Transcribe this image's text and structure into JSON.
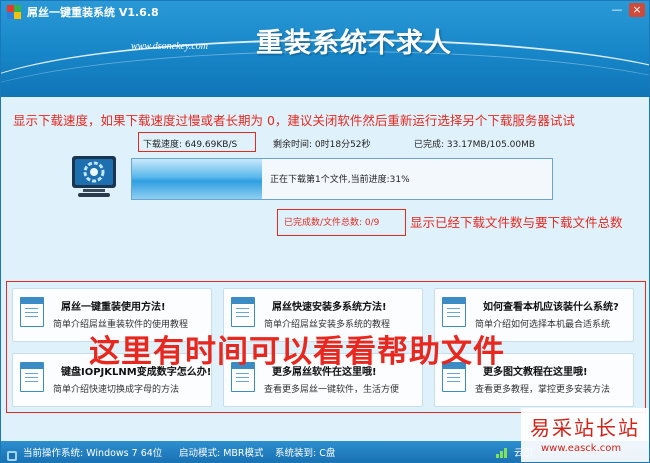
{
  "window": {
    "title": "屌丝一键重装系统 V1.6.8",
    "website": "www.dsonekey.com",
    "slogan": "重装系统不求人",
    "buttons": {
      "minimize": "—",
      "close": "×"
    },
    "logo_colors": [
      "#e53a2c",
      "#36b24a",
      "#2e7fd9",
      "#f4c20d"
    ]
  },
  "annotations": {
    "top": "显示下载速度，如果下载速度过慢或者长期为 0，建议关闭软件然后重新运行选择另个下载服务器试试",
    "right": "显示已经下载文件数与要下载文件总数",
    "overlay": "这里有时间可以看看帮助文件"
  },
  "download": {
    "speed": "下载速度: 649.69KB/S",
    "remaining": "剩余时间: 0时18分52秒",
    "completed": "已完成: 33.17MB/105.00MB",
    "progress_text": "正在下载第1个文件,当前进度:31%",
    "progress_value": 0.31,
    "file_count": "已完成数/文件总数: 0/9"
  },
  "help_cards": [
    {
      "title": "屌丝一键重装使用方法!",
      "desc": "简单介绍屌丝重装软件的使用教程"
    },
    {
      "title": "屌丝快速安装多系统方法!",
      "desc": "简单介绍屌丝安装多系统的教程"
    },
    {
      "title": "如何查看本机应该装什么系统?",
      "desc": "简单介绍如何选择本机最合适系统"
    },
    {
      "title": "键盘IOPJKLNM变成数字怎么办!",
      "desc": "简单介绍快速切换成字母的方法"
    },
    {
      "title": "更多屌丝软件在这里哦!",
      "desc": "查看更多屌丝一键软件，生活方便"
    },
    {
      "title": "更多图文教程在这里哦!",
      "desc": "查看更多教程，掌控更多安装方法"
    }
  ],
  "status_bar": {
    "current_os": "当前操作系统: Windows 7 64位",
    "boot_mode": "启动模式: MBR模式",
    "install_to": "系统装到: C盘",
    "cloud": "云引"
  },
  "watermark": {
    "line1": "易采站长站",
    "line2": "www.easck.com"
  },
  "colors": {
    "accent": "#1786c8",
    "annotation": "#e8281f",
    "window_bg": "#dff1fb"
  }
}
